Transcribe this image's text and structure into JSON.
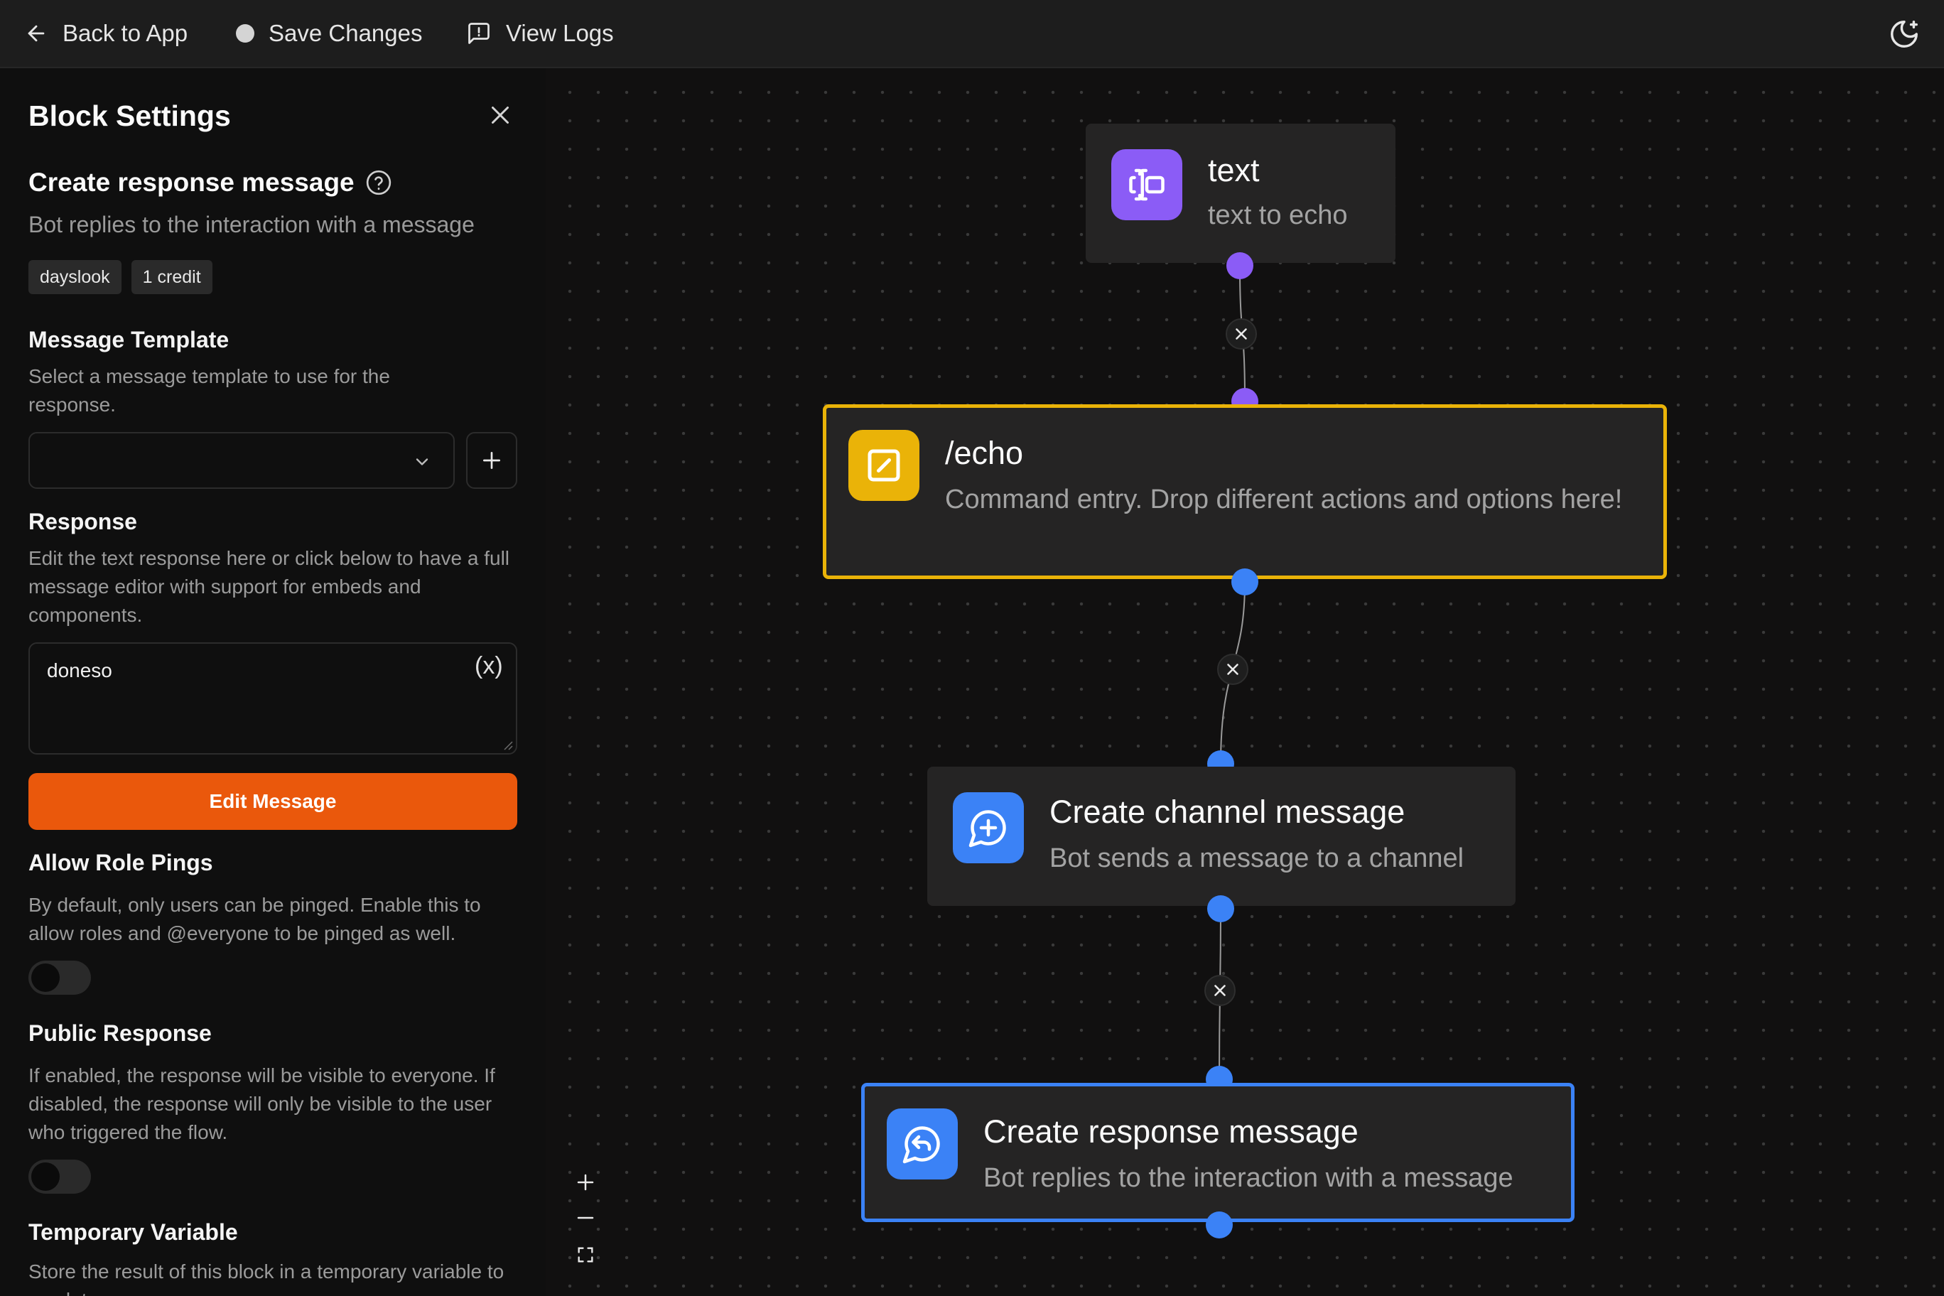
{
  "topbar": {
    "back_label": "Back to App",
    "save_label": "Save Changes",
    "logs_label": "View Logs"
  },
  "sidebar": {
    "title": "Block Settings",
    "block_name": "Create response message",
    "block_desc": "Bot replies to the interaction with a message",
    "tags": [
      "dayslook",
      "1 credit"
    ],
    "message_template": {
      "label": "Message Template",
      "help": "Select a message template to use for the response.",
      "selected": ""
    },
    "response": {
      "label": "Response",
      "help": "Edit the text response here or click below to have a full message editor with support for embeds and components.",
      "value": "doneso",
      "variable_icon": "(x)"
    },
    "edit_button": "Edit Message",
    "role_pings": {
      "label": "Allow Role Pings",
      "help": "By default, only users can be pinged. Enable this to allow roles and @everyone to be pinged as well.",
      "enabled": false
    },
    "public_response": {
      "label": "Public Response",
      "help": "If enabled, the response will be visible to everyone. If disabled, the response will only be visible to the user who triggered the flow.",
      "enabled": false
    },
    "temp_var": {
      "label": "Temporary Variable",
      "help": "Store the result of this block in a temporary variable to use later."
    }
  },
  "nodes": {
    "text": {
      "title": "text",
      "desc": "text to echo",
      "color": "#8b5cf6",
      "icon": "text-cursor-icon"
    },
    "echo": {
      "title": "/echo",
      "desc": "Command entry. Drop different actions and options here!",
      "color": "#eab308",
      "icon": "slash-command-icon"
    },
    "channel": {
      "title": "Create channel message",
      "desc": "Bot sends a message to a channel",
      "color": "#3b82f6",
      "icon": "message-plus-icon"
    },
    "response": {
      "title": "Create response message",
      "desc": "Bot replies to the interaction with a message",
      "color": "#3b82f6",
      "icon": "message-reply-icon"
    }
  },
  "colors": {
    "accent": "#ea580c",
    "option_handle": "#8b5cf6",
    "action_handle": "#3b82f6",
    "selected_entry": "#eab308"
  }
}
